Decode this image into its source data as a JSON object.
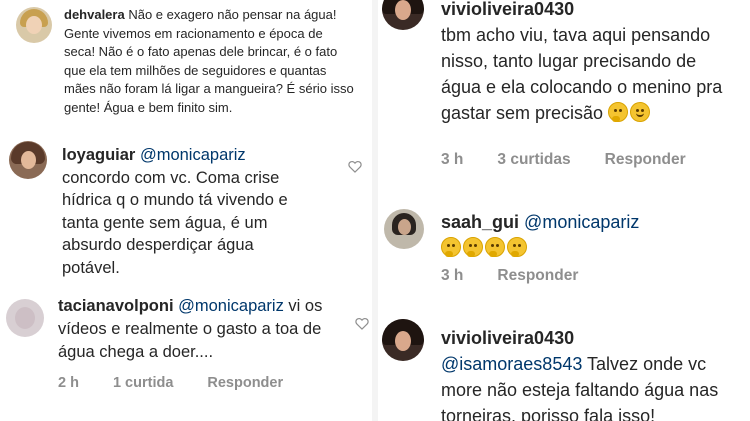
{
  "left": {
    "comments": [
      {
        "username": "dehvalera",
        "text": "Não e exagero não pensar na água! Gente vivemos em racionamento e época de seca! Não é o fato apenas dele brincar, é o fato que ela tem milhões de seguidores e quantas mães não foram lá ligar a mangueira? É sério isso gente! Água e bem finito sim."
      },
      {
        "username": "loyaguiar",
        "mention": "@monicapariz",
        "text": "concordo com vc. Coma crise hídrica q o mundo tá vivendo e tanta gente sem água, é um absurdo desperdiçar água potável."
      },
      {
        "username": "tacianavolponi",
        "mention": "@monicapariz",
        "text": "vi os vídeos e realmente o gasto a toa de água chega a doer....",
        "time": "2 h",
        "likes": "1 curtida",
        "reply": "Responder"
      }
    ]
  },
  "right": {
    "comments": [
      {
        "username": "vivioliveira0430",
        "text": "tbm acho viu, tava aqui pensando nisso, tanto lugar precisando de água e ela colocando o menino pra gastar sem precisão",
        "emojis": [
          "thinking-face",
          "smiling-face"
        ],
        "time": "3 h",
        "likes": "3 curtidas",
        "reply": "Responder"
      },
      {
        "username": "saah_gui",
        "mention": "@monicapariz",
        "emojis": [
          "thinking-face",
          "thinking-face",
          "thinking-face",
          "thinking-face"
        ],
        "time": "3 h",
        "reply": "Responder"
      },
      {
        "username": "vivioliveira0430",
        "mention": "@isamoraes8543",
        "text": "Talvez onde vc more não esteja faltando água nas torneiras, porisso fala isso!"
      }
    ]
  },
  "colors": {
    "text": "#262626",
    "mention": "#00376b",
    "meta": "#8e8e8e"
  }
}
